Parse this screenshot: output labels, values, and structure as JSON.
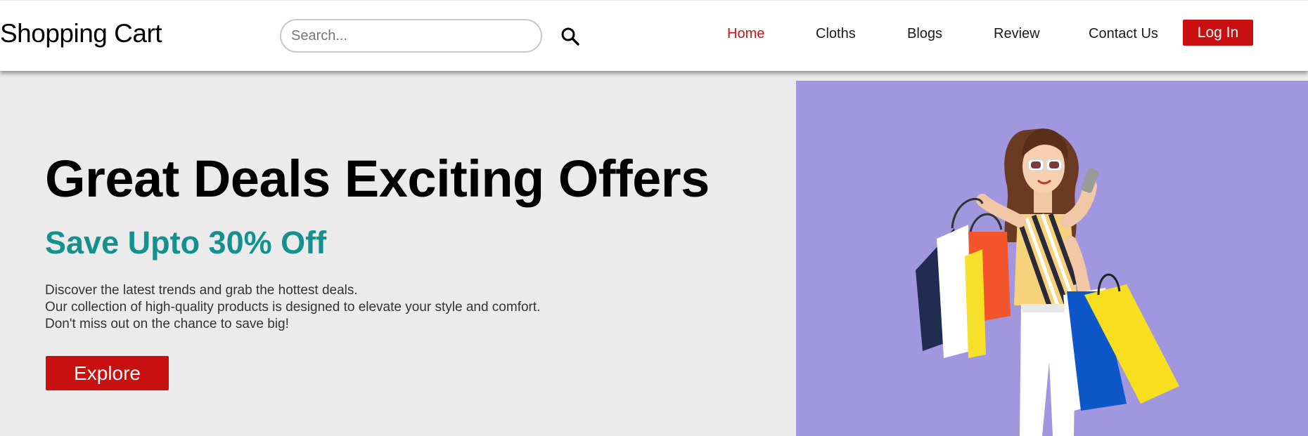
{
  "header": {
    "brand": "Shopping Cart",
    "search_placeholder": "Search...",
    "nav": [
      {
        "label": "Home",
        "active": true
      },
      {
        "label": "Cloths",
        "active": false
      },
      {
        "label": "Blogs",
        "active": false
      },
      {
        "label": "Review",
        "active": false
      },
      {
        "label": "Contact Us",
        "active": false
      }
    ],
    "login_label": "Log In"
  },
  "hero": {
    "title": "Great Deals Exciting Offers",
    "subtitle": "Save Upto 30% Off",
    "description": [
      "Discover the latest trends and grab the hottest deals.",
      "Our collection of high-quality products is designed to elevate your style and comfort.",
      "Don't miss out on the chance to save big!"
    ],
    "cta_label": "Explore",
    "image": "woman-with-shopping-bags-photo"
  },
  "icons": {
    "search": "search-icon"
  },
  "colors": {
    "accent_red": "#c81010",
    "nav_active": "#c81414",
    "subtitle_teal": "#14918f",
    "hero_bg": "#ebebeb",
    "image_bg": "#a097df"
  }
}
